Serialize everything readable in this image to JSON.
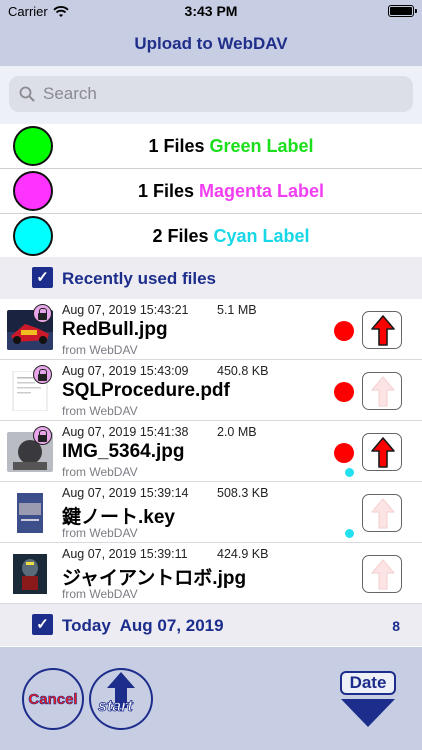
{
  "status": {
    "carrier": "Carrier",
    "time": "3:43 PM"
  },
  "nav": {
    "title": "Upload to WebDAV"
  },
  "search": {
    "placeholder": "Search"
  },
  "labels": [
    {
      "count": "1 Files",
      "name": "Green Label",
      "color": "#00ff00"
    },
    {
      "count": "1 Files",
      "name": "Magenta Label",
      "color": "#ff33ff"
    },
    {
      "count": "2 Files",
      "name": "Cyan Label",
      "color": "#00ffff"
    }
  ],
  "recent": {
    "title": "Recently used files",
    "checked": true
  },
  "files": [
    {
      "date": "Aug 07, 2019 15:43:21",
      "size": "5.1 MB",
      "name": "RedBull.jpg",
      "source": "from WebDAV",
      "label": "red",
      "upload_enabled": true,
      "cyan": false
    },
    {
      "date": "Aug 07, 2019 15:43:09",
      "size": "450.8 KB",
      "name": "SQLProcedure.pdf",
      "source": "from WebDAV",
      "label": "red",
      "upload_enabled": false,
      "cyan": false
    },
    {
      "date": "Aug 07, 2019 15:41:38",
      "size": "2.0 MB",
      "name": "IMG_5364.jpg",
      "source": "from WebDAV",
      "label": "red",
      "upload_enabled": true,
      "cyan": true
    },
    {
      "date": "Aug 07, 2019 15:39:14",
      "size": "508.3 KB",
      "name": "鍵ノート.key",
      "source": "from WebDAV",
      "label": "none",
      "upload_enabled": false,
      "cyan": true
    },
    {
      "date": "Aug 07, 2019 15:39:11",
      "size": "424.9 KB",
      "name": "ジャイアントロボ.jpg",
      "source": "from WebDAV",
      "label": "none",
      "upload_enabled": false,
      "cyan": false
    }
  ],
  "today": {
    "title": "Today",
    "date": "Aug 07, 2019",
    "count": "8",
    "checked": true
  },
  "toolbar": {
    "cancel_label": "Cancel",
    "start_label": "start",
    "date_label": "Date"
  },
  "colors": {
    "accent": "#1d2d8c",
    "bar": "#c7cde2",
    "red": "#ff0000",
    "cyan": "#22e0ee"
  }
}
